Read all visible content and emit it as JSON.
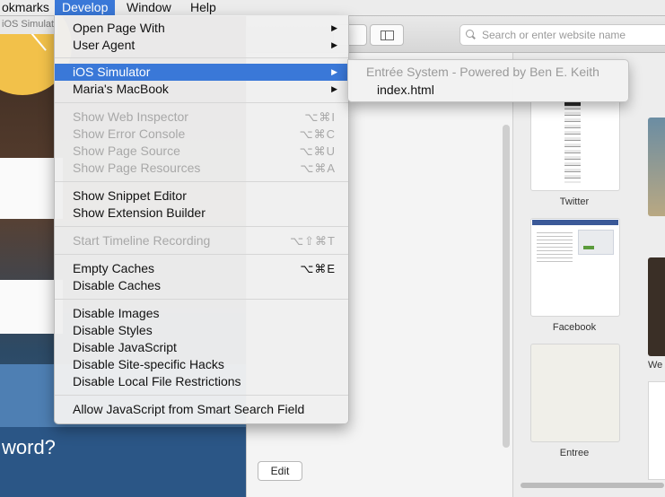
{
  "menubar": {
    "items": [
      "okmarks",
      "Develop",
      "Window",
      "Help"
    ]
  },
  "background_page": {
    "tab_label": "iOS Simulat",
    "forgot_text": "word?"
  },
  "toolbar": {
    "search_placeholder": "Search or enter website name"
  },
  "favorites": {
    "edit_label": "Edit"
  },
  "top_sites": [
    {
      "caption": "Twitter"
    },
    {
      "caption": "Facebook"
    },
    {
      "caption": "Entree"
    },
    {
      "caption": "We"
    }
  ],
  "develop_menu": {
    "items": [
      {
        "label": "Open Page With",
        "shortcut": "",
        "submenu": true,
        "disabled": false,
        "highlighted": false
      },
      {
        "label": "User Agent",
        "shortcut": "",
        "submenu": true,
        "disabled": false,
        "highlighted": false
      },
      {
        "label": "iOS Simulator",
        "shortcut": "",
        "submenu": true,
        "disabled": false,
        "highlighted": true
      },
      {
        "label": "Maria's MacBook",
        "shortcut": "",
        "submenu": true,
        "disabled": false,
        "highlighted": false
      },
      {
        "label": "Show Web Inspector",
        "shortcut": "⌥⌘I",
        "submenu": false,
        "disabled": true,
        "highlighted": false
      },
      {
        "label": "Show Error Console",
        "shortcut": "⌥⌘C",
        "submenu": false,
        "disabled": true,
        "highlighted": false
      },
      {
        "label": "Show Page Source",
        "shortcut": "⌥⌘U",
        "submenu": false,
        "disabled": true,
        "highlighted": false
      },
      {
        "label": "Show Page Resources",
        "shortcut": "⌥⌘A",
        "submenu": false,
        "disabled": true,
        "highlighted": false
      },
      {
        "label": "Show Snippet Editor",
        "shortcut": "",
        "submenu": false,
        "disabled": false,
        "highlighted": false
      },
      {
        "label": "Show Extension Builder",
        "shortcut": "",
        "submenu": false,
        "disabled": false,
        "highlighted": false
      },
      {
        "label": "Start Timeline Recording",
        "shortcut": "⌥⇧⌘T",
        "submenu": false,
        "disabled": true,
        "highlighted": false
      },
      {
        "label": "Empty Caches",
        "shortcut": "⌥⌘E",
        "submenu": false,
        "disabled": false,
        "highlighted": false
      },
      {
        "label": "Disable Caches",
        "shortcut": "",
        "submenu": false,
        "disabled": false,
        "highlighted": false
      },
      {
        "label": "Disable Images",
        "shortcut": "",
        "submenu": false,
        "disabled": false,
        "highlighted": false
      },
      {
        "label": "Disable Styles",
        "shortcut": "",
        "submenu": false,
        "disabled": false,
        "highlighted": false
      },
      {
        "label": "Disable JavaScript",
        "shortcut": "",
        "submenu": false,
        "disabled": false,
        "highlighted": false
      },
      {
        "label": "Disable Site-specific Hacks",
        "shortcut": "",
        "submenu": false,
        "disabled": false,
        "highlighted": false
      },
      {
        "label": "Disable Local File Restrictions",
        "shortcut": "",
        "submenu": false,
        "disabled": false,
        "highlighted": false
      },
      {
        "label": "Allow JavaScript from Smart Search Field",
        "shortcut": "",
        "submenu": false,
        "disabled": false,
        "highlighted": false
      }
    ]
  },
  "ios_submenu": {
    "header": "Entrée System - Powered by Ben E. Keith",
    "item": "index.html"
  },
  "colors": {
    "highlight": "#3a78d8",
    "disabled_text": "#a8a8a8"
  }
}
